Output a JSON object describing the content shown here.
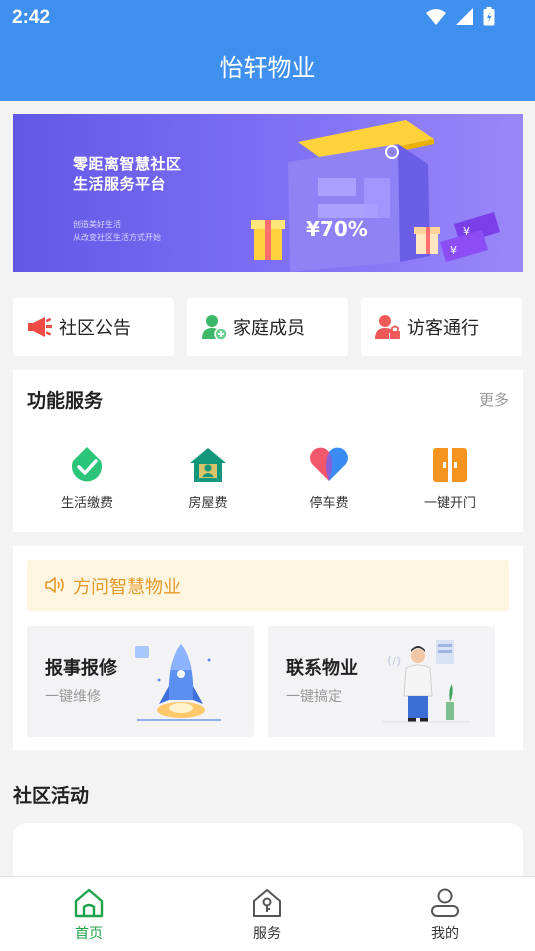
{
  "status_bar": {
    "time": "2:42"
  },
  "header": {
    "title": "怡轩物业"
  },
  "banner": {
    "headline_line1": "零距离智慧社区",
    "headline_line2": "生活服务平台",
    "sub_line1": "创造美好生活",
    "sub_line2": "从改变社区生活方式开始",
    "badge": "¥70%"
  },
  "quick_links": [
    {
      "label": "社区公告",
      "icon": "megaphone-icon"
    },
    {
      "label": "家庭成员",
      "icon": "family-member-icon"
    },
    {
      "label": "访客通行",
      "icon": "visitor-lock-icon"
    }
  ],
  "functions": {
    "title": "功能服务",
    "more_label": "更多",
    "items": [
      {
        "label": "生活缴费",
        "icon": "check-drop-icon",
        "color": "#2bc57a"
      },
      {
        "label": "房屋费",
        "icon": "house-icon",
        "color": "#12977a"
      },
      {
        "label": "停车费",
        "icon": "heart-icon",
        "color": "#f0576a"
      },
      {
        "label": "一键开门",
        "icon": "door-icon",
        "color": "#f6941f"
      }
    ]
  },
  "notice": {
    "text": "方问智慧物业",
    "icon": "speaker-icon"
  },
  "cards": [
    {
      "title": "报事报修",
      "subtitle": "一键维修"
    },
    {
      "title": "联系物业",
      "subtitle": "一键搞定"
    }
  ],
  "activities": {
    "title": "社区活动"
  },
  "bottom_nav": {
    "items": [
      {
        "label": "首页",
        "icon": "home-icon",
        "active": true
      },
      {
        "label": "服务",
        "icon": "service-house-icon",
        "active": false
      },
      {
        "label": "我的",
        "icon": "user-icon",
        "active": false
      }
    ]
  },
  "colors": {
    "primary": "#3f8fef",
    "active_nav": "#1fa34a",
    "notice_text": "#e59a2a"
  }
}
